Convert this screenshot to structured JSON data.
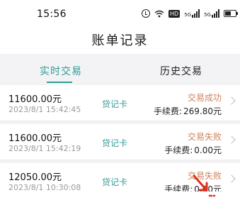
{
  "statusbar": {
    "time": "15:56",
    "icons": [
      "alarm-icon",
      "wifi-icon",
      "hd-badge",
      "signal-icon",
      "signal-icon",
      "battery-icon"
    ],
    "hd_text": "HD",
    "sig1_label": "5G",
    "sig2_label": "5G",
    "battery_level": 0.55
  },
  "header": {
    "title": "账单记录"
  },
  "tabs": [
    {
      "label": "实时交易",
      "active": true
    },
    {
      "label": "历史交易",
      "active": false
    }
  ],
  "transactions": [
    {
      "amount": "11600.00元",
      "datetime": "2023/8/1 15:42:45",
      "card_type": "贷记卡",
      "status": "交易成功",
      "fee_label": "手续费:",
      "fee_value": "269.80元"
    },
    {
      "amount": "11600.00元",
      "datetime": "2023/8/1 15:42:19",
      "card_type": "贷记卡",
      "status": "交易失败",
      "fee_label": "手续费:",
      "fee_value": "0.00元"
    },
    {
      "amount": "12050.00元",
      "datetime": "2023/8/1 10:30:08",
      "card_type": "贷记卡",
      "status": "交易失败",
      "fee_label": "手续费:",
      "fee_value": "0.00元"
    }
  ],
  "colors": {
    "accent": "#2e9c97",
    "status": "#d0825a",
    "annotation": "#e0301e"
  }
}
